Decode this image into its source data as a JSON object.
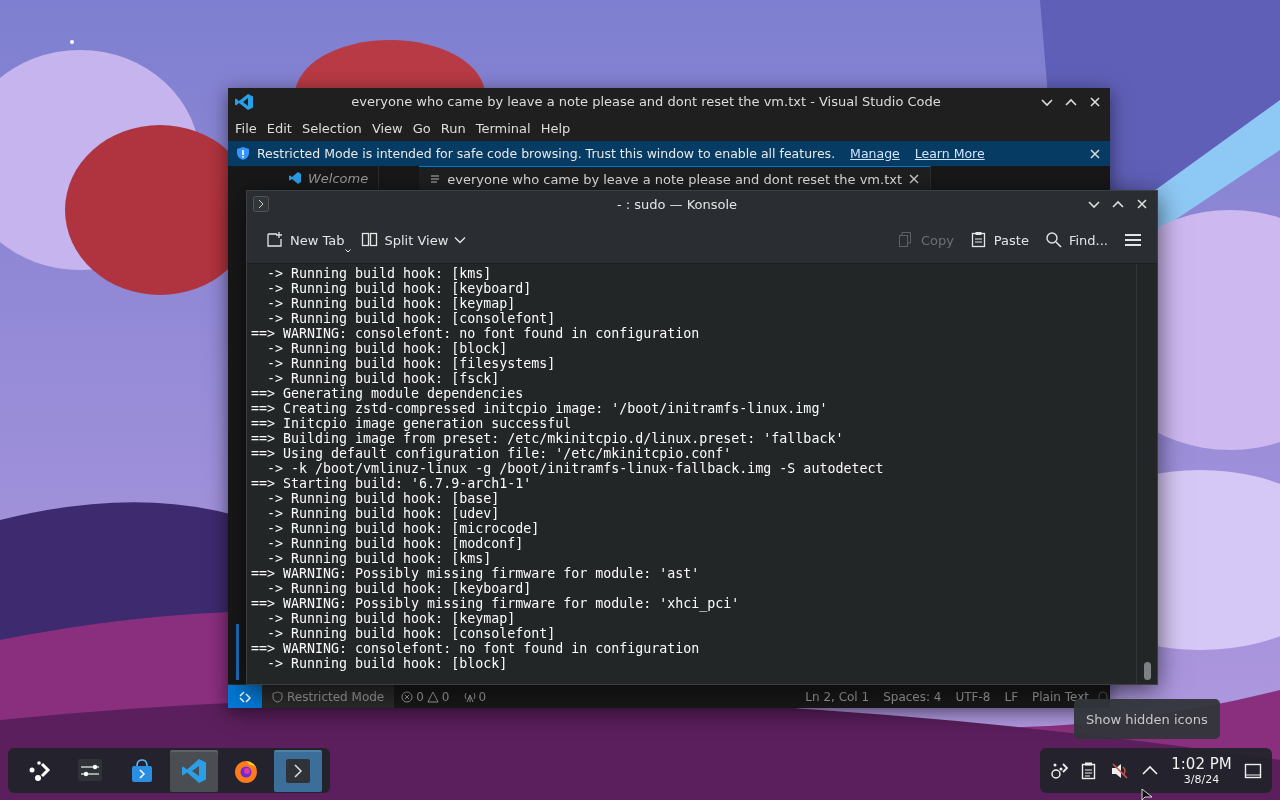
{
  "vscode": {
    "title": "everyone who came by leave a note please and dont reset the vm.txt - Visual Studio Code",
    "menu": [
      "File",
      "Edit",
      "Selection",
      "View",
      "Go",
      "Run",
      "Terminal",
      "Help"
    ],
    "banner": {
      "text": "Restricted Mode is intended for safe code browsing. Trust this window to enable all features.",
      "links": [
        "Manage",
        "Learn More"
      ]
    },
    "tabs": [
      {
        "label": "Welcome",
        "selected": false,
        "kind": "welcome"
      },
      {
        "label": "everyone who came by leave a note please and dont reset the vm.txt",
        "selected": true,
        "kind": "text"
      }
    ],
    "status_bar": {
      "mode": "Restricted Mode",
      "errors": "0",
      "warnings": "0",
      "ports": "0",
      "items": [
        "Ln 2, Col 1",
        "Spaces: 4",
        "UTF-8",
        "LF",
        "Plain Text"
      ]
    }
  },
  "konsole": {
    "title": "- : sudo — Konsole",
    "toolbar": [
      {
        "kind": "new-tab",
        "label": "New Tab",
        "disabled": false
      },
      {
        "kind": "split-view",
        "label": "Split View",
        "disabled": false
      },
      {
        "kind": "copy",
        "label": "Copy",
        "disabled": true
      },
      {
        "kind": "paste",
        "label": "Paste",
        "disabled": false
      },
      {
        "kind": "find",
        "label": "Find...",
        "disabled": false
      },
      {
        "kind": "menu",
        "disabled": false
      }
    ],
    "lines": [
      "  -> Running build hook: [kms]",
      "  -> Running build hook: [keyboard]",
      "  -> Running build hook: [keymap]",
      "  -> Running build hook: [consolefont]",
      "==> WARNING: consolefont: no font found in configuration",
      "  -> Running build hook: [block]",
      "  -> Running build hook: [filesystems]",
      "  -> Running build hook: [fsck]",
      "==> Generating module dependencies",
      "==> Creating zstd-compressed initcpio image: '/boot/initramfs-linux.img'",
      "==> Initcpio image generation successful",
      "==> Building image from preset: /etc/mkinitcpio.d/linux.preset: 'fallback'",
      "==> Using default configuration file: '/etc/mkinitcpio.conf'",
      "  -> -k /boot/vmlinuz-linux -g /boot/initramfs-linux-fallback.img -S autodetect",
      "==> Starting build: '6.7.9-arch1-1'",
      "  -> Running build hook: [base]",
      "  -> Running build hook: [udev]",
      "  -> Running build hook: [microcode]",
      "  -> Running build hook: [modconf]",
      "  -> Running build hook: [kms]",
      "==> WARNING: Possibly missing firmware for module: 'ast'",
      "  -> Running build hook: [keyboard]",
      "==> WARNING: Possibly missing firmware for module: 'xhci_pci'",
      "  -> Running build hook: [keymap]",
      "  -> Running build hook: [consolefont]",
      "==> WARNING: consolefont: no font found in configuration",
      "  -> Running build hook: [block]"
    ]
  },
  "taskbar": {
    "apps": [
      {
        "kind": "launcher",
        "open": false,
        "selected": false
      },
      {
        "kind": "settings",
        "open": false,
        "selected": false
      },
      {
        "kind": "store",
        "open": false,
        "selected": false
      },
      {
        "kind": "vscode",
        "open": true,
        "selected": false
      },
      {
        "kind": "firefox",
        "open": false,
        "selected": false
      },
      {
        "kind": "terminal",
        "open": true,
        "selected": true
      }
    ],
    "tray": [
      {
        "kind": "network"
      },
      {
        "kind": "clipboard"
      },
      {
        "kind": "volume-muted"
      },
      {
        "kind": "expand"
      }
    ],
    "clock": {
      "time": "1:02 PM",
      "date": "3/8/24"
    },
    "tooltip": "Show hidden icons"
  }
}
